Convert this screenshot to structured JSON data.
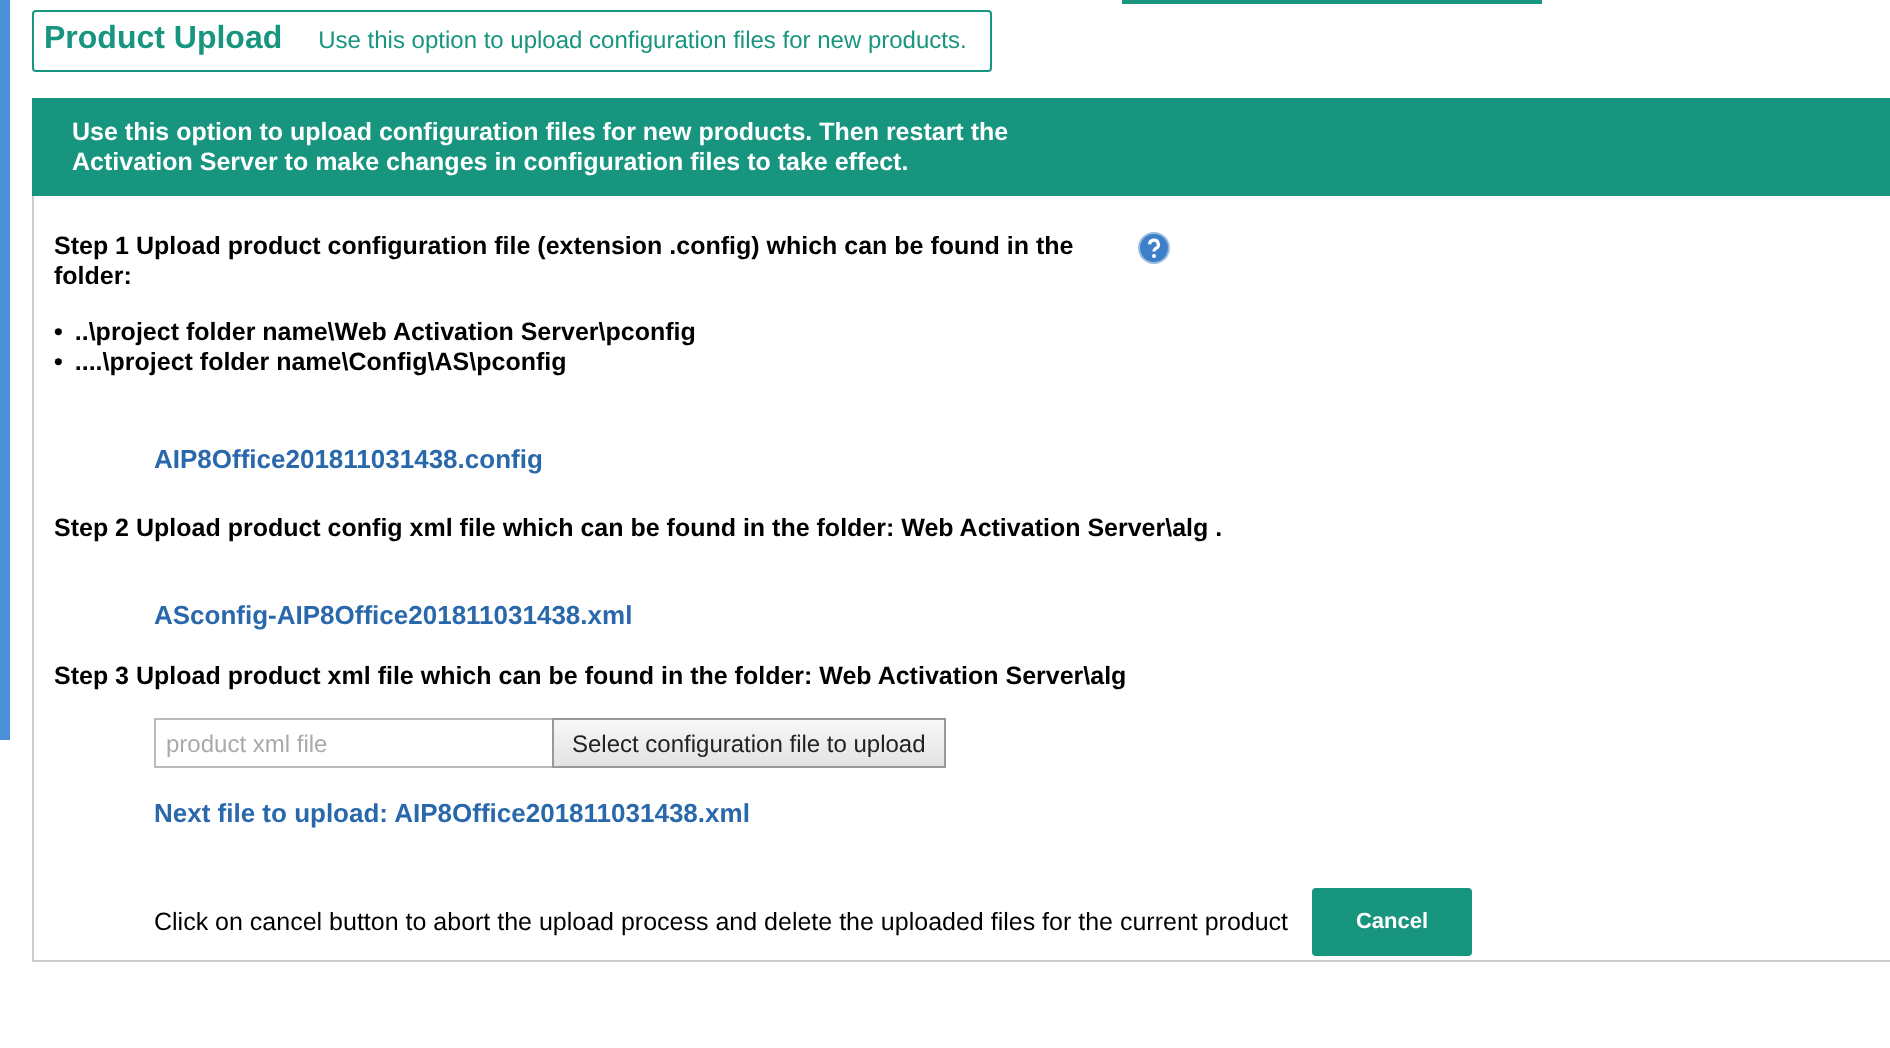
{
  "header": {
    "title": "Product Upload",
    "subtitle": "Use this option to upload configuration files for new products."
  },
  "banner": "Use this option to upload configuration files for new products. Then restart the Activation Server to make changes in configuration files to take effect.",
  "step1": {
    "text": "Step 1 Upload product configuration file (extension .config) which can be found in the folder:",
    "folders": [
      {
        "bullet": "•",
        "path": "..\\project folder name\\Web Activation Server\\pconfig"
      },
      {
        "bullet": "•",
        "path": "....\\project folder name\\Config\\AS\\pconfig"
      }
    ],
    "file": "AIP8Office201811031438.config"
  },
  "step2": {
    "text": "Step 2 Upload product config xml file which can be found in the folder: Web Activation Server\\alg .",
    "file": "ASconfig-AIP8Office201811031438.xml"
  },
  "step3": {
    "text": "Step 3 Upload product xml file which can be found in the folder: Web Activation Server\\alg",
    "placeholder": "product xml file",
    "button": "Select configuration file to upload",
    "next": "Next file to upload: AIP8Office201811031438.xml"
  },
  "cancel": {
    "text": "Click on cancel button to abort the upload process and delete the uploaded files for the current product",
    "button": "Cancel"
  }
}
